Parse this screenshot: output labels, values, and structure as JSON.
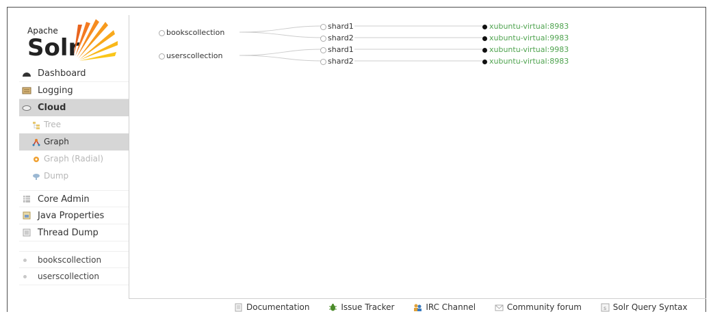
{
  "logo": {
    "apache": "Apache",
    "solr": "Solr"
  },
  "nav": {
    "dashboard": "Dashboard",
    "logging": "Logging",
    "cloud": "Cloud",
    "cloud_sub": {
      "tree": "Tree",
      "graph": "Graph",
      "graph_radial": "Graph (Radial)",
      "dump": "Dump"
    },
    "core_admin": "Core Admin",
    "java_properties": "Java Properties",
    "thread_dump": "Thread Dump",
    "cores": [
      "bookscollection",
      "userscollection"
    ]
  },
  "graph": {
    "collections": [
      {
        "name": "bookscollection",
        "shards": [
          {
            "name": "shard1",
            "node": "xubuntu-virtual:8983"
          },
          {
            "name": "shard2",
            "node": "xubuntu-virtual:9983"
          }
        ]
      },
      {
        "name": "userscollection",
        "shards": [
          {
            "name": "shard1",
            "node": "xubuntu-virtual:9983"
          },
          {
            "name": "shard2",
            "node": "xubuntu-virtual:8983"
          }
        ]
      }
    ]
  },
  "footer": {
    "documentation": "Documentation",
    "issue_tracker": "Issue Tracker",
    "irc_channel": "IRC Channel",
    "community_forum": "Community forum",
    "solr_query_syntax": "Solr Query Syntax"
  },
  "colors": {
    "active_bg": "#d6d6d6",
    "node_green": "#4fa34f",
    "inactive_text": "#b7b7b7"
  }
}
